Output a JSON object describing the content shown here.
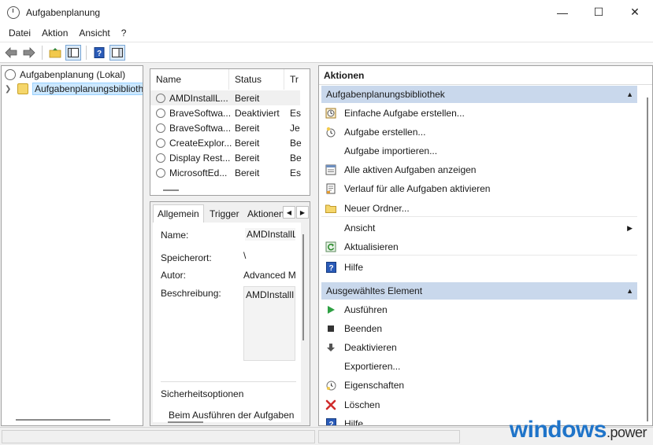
{
  "window": {
    "title": "Aufgabenplanung",
    "minimize_glyph": "—",
    "maximize_glyph": "☐",
    "close_glyph": "✕"
  },
  "menu": [
    "Datei",
    "Aktion",
    "Ansicht",
    "?"
  ],
  "toolbar": {
    "icons": [
      "back-arrow-icon",
      "forward-arrow-icon",
      "up-folder-icon",
      "show-hide-tree-icon",
      "help-icon",
      "show-hide-action-pane-icon"
    ]
  },
  "tree": {
    "root": "Aufgabenplanung (Lokal)",
    "child": "Aufgabenplanungsbibliothek"
  },
  "task_list": {
    "columns": [
      "Name",
      "Status",
      "Tr"
    ],
    "rows": [
      {
        "name": "AMDInstallL...",
        "status": "Bereit",
        "trigger": ""
      },
      {
        "name": "BraveSoftwa...",
        "status": "Deaktiviert",
        "trigger": "Es"
      },
      {
        "name": "BraveSoftwa...",
        "status": "Bereit",
        "trigger": "Je"
      },
      {
        "name": "CreateExplor...",
        "status": "Bereit",
        "trigger": "Be"
      },
      {
        "name": "Display Rest...",
        "status": "Bereit",
        "trigger": "Be"
      },
      {
        "name": "MicrosoftEd...",
        "status": "Bereit",
        "trigger": "Es"
      }
    ]
  },
  "details": {
    "tabs": [
      "Allgemein",
      "Trigger",
      "Aktionen"
    ],
    "name_label": "Name:",
    "name_value": "AMDInstallL",
    "location_label": "Speicherort:",
    "location_value": "\\",
    "author_label": "Autor:",
    "author_value": "Advanced M",
    "description_label": "Beschreibung:",
    "description_value": "AMDInstallI",
    "security_title": "Sicherheitsoptionen",
    "security_text": "Beim Ausführen der Aufgaben"
  },
  "actions": {
    "header": "Aktionen",
    "section1": {
      "title": "Aufgabenplanungsbibliothek",
      "items": [
        "Einfache Aufgabe erstellen...",
        "Aufgabe erstellen...",
        "Aufgabe importieren...",
        "Alle aktiven Aufgaben anzeigen",
        "Verlauf für alle Aufgaben aktivieren",
        "Neuer Ordner...",
        "Ansicht",
        "Aktualisieren",
        "Hilfe"
      ]
    },
    "section2": {
      "title": "Ausgewähltes Element",
      "items": [
        "Ausführen",
        "Beenden",
        "Deaktivieren",
        "Exportieren...",
        "Eigenschaften",
        "Löschen",
        "Hilfe"
      ]
    }
  },
  "watermark": {
    "main": "windows",
    "suffix": "power",
    "dot": "."
  }
}
